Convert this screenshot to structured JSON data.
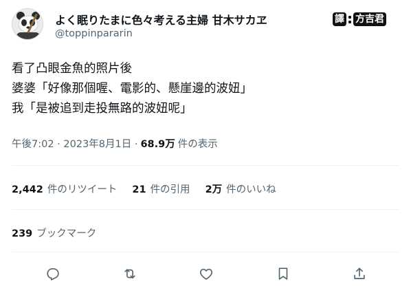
{
  "author": {
    "display_name": "よく眠りたまに色々考える主婦 甘木サカヱ",
    "handle": "@toppinpararin"
  },
  "stamp": {
    "left_text": "譯",
    "right_text": "方吉君"
  },
  "tweet": {
    "lines": [
      "看了凸眼金魚的照片後",
      "婆婆「好像那個喔、電影的、懸崖邊的波妞」",
      "我「是被追到走投無路的波妞呢」"
    ],
    "timestamp": "午後7:02 · 2023年8月1日 · ",
    "views_count": "68.9万",
    "views_label": "件の表示"
  },
  "stats": {
    "retweets_count": "2,442",
    "retweets_label": "件のリツイート",
    "quotes_count": "21",
    "quotes_label": "件の引用",
    "likes_count": "2万",
    "likes_label": "件のいいね"
  },
  "bookmarks": {
    "count": "239",
    "label": "ブックマーク"
  },
  "actions": [
    "reply-icon",
    "retweet-icon",
    "like-icon",
    "bookmark-icon",
    "share-icon"
  ],
  "colors": {
    "text": "#0f1419",
    "secondary": "#536471",
    "divider": "#eff3f4"
  }
}
